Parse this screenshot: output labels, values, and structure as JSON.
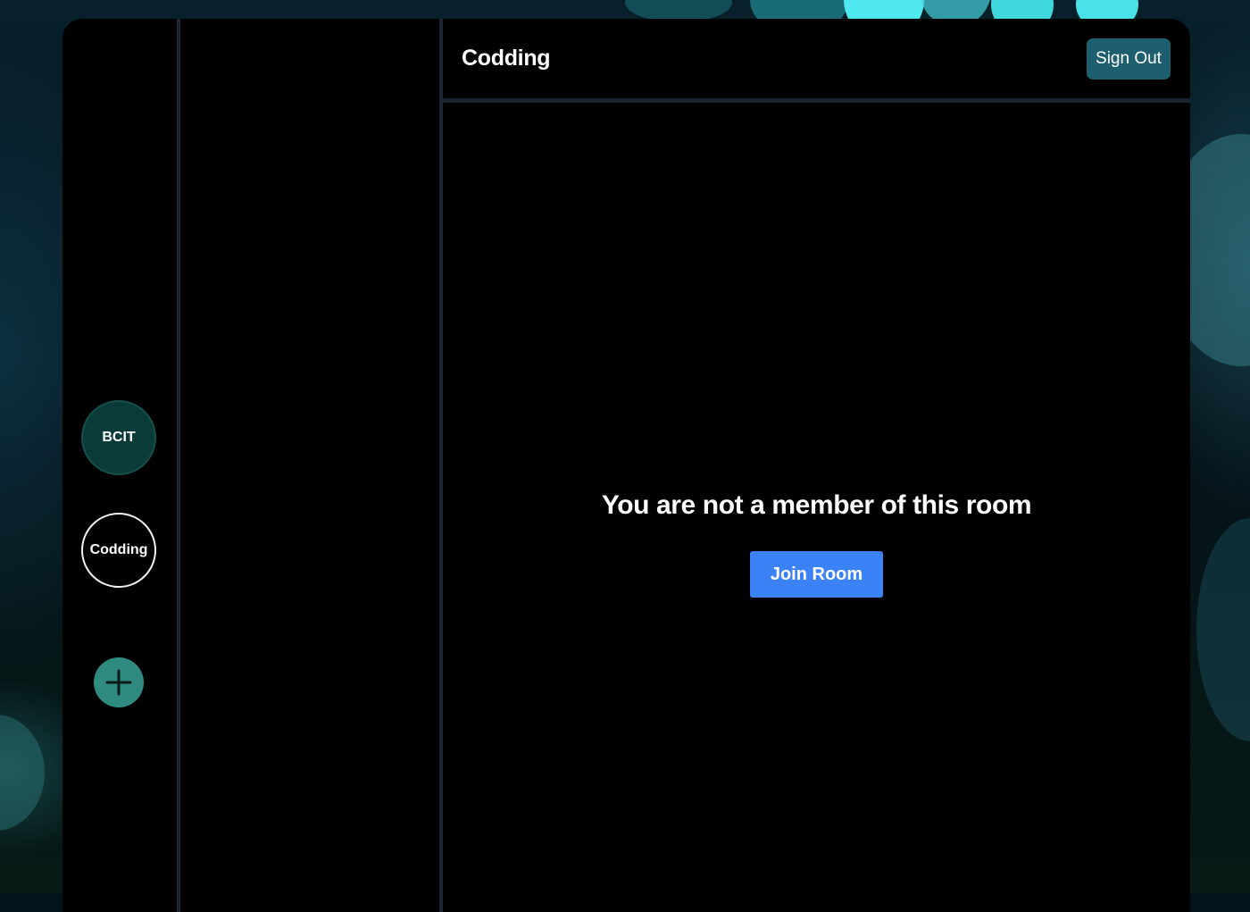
{
  "header": {
    "room_title": "Codding",
    "sign_out_label": "Sign Out"
  },
  "servers": [
    {
      "label": "BCIT"
    },
    {
      "label": "Codding"
    }
  ],
  "add_server_icon": "plus-icon",
  "main": {
    "notice": "You are not a member of this room",
    "join_label": "Join Room"
  },
  "colors": {
    "accent_blue": "#3b82f6",
    "sign_out_bg": "#1d5f6f",
    "server_active_bg": "#0b3b38",
    "add_button_bg": "#2f8a80"
  }
}
